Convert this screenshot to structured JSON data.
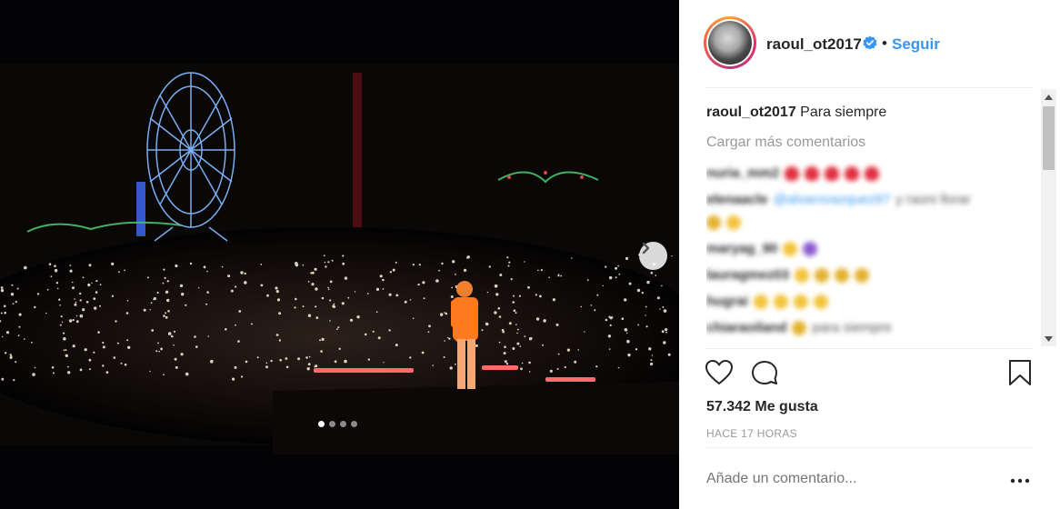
{
  "post": {
    "username": "raoul_ot2017",
    "separator": "•",
    "follow_label": "Seguir",
    "caption_user": "raoul_ot2017",
    "caption_text": "Para siempre",
    "load_more_label": "Cargar más comentarios",
    "likes_text": "57.342 Me gusta",
    "timestamp": "HACE 17 HORAS",
    "comment_placeholder": "Añade un comentario..."
  },
  "comments": [
    {
      "user": "nuria_mm2",
      "text": ""
    },
    {
      "user": "elenaacle",
      "mention": "@alvarovazquez97",
      "text": "y raoni llorar"
    },
    {
      "user": "maryag_90",
      "text": ""
    },
    {
      "user": "lauragmez03",
      "text": ""
    },
    {
      "user": "hugrai",
      "text": ""
    },
    {
      "user": "chiaraoiland",
      "text": "para siempre"
    }
  ],
  "carousel": {
    "count": 4,
    "active": 0
  },
  "colors": {
    "accent": "#3897f0",
    "text": "#262626",
    "muted": "#999999"
  },
  "icons": [
    "verified-badge-icon",
    "next-arrow-icon",
    "heart-icon",
    "comment-icon",
    "bookmark-icon",
    "more-options-icon"
  ]
}
